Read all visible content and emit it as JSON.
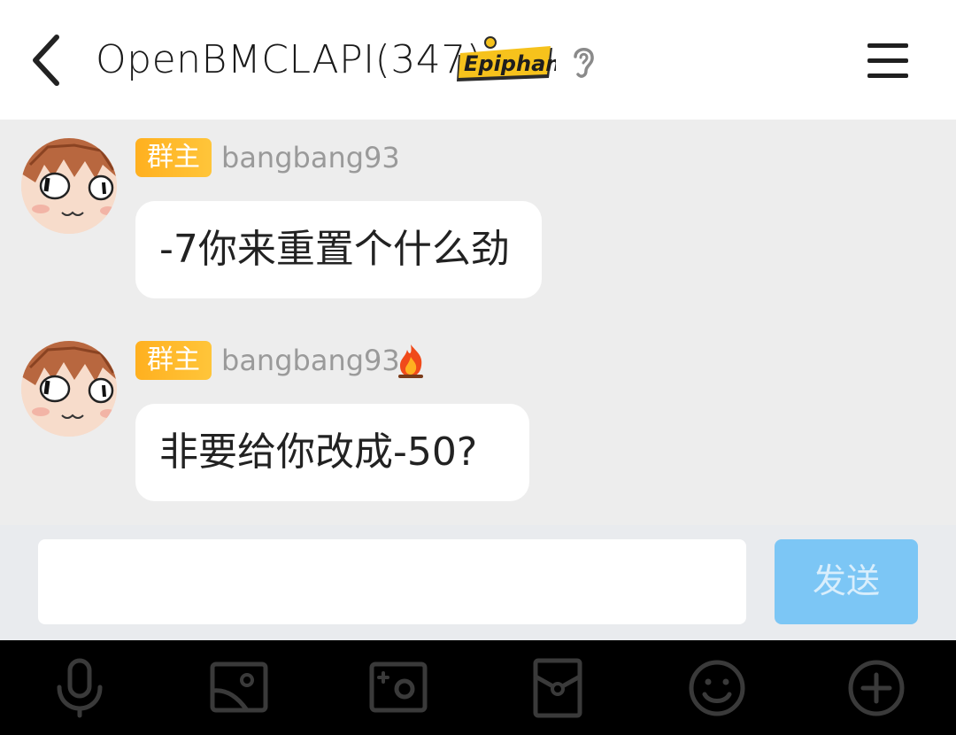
{
  "header": {
    "title": "OpenBMCLAPI(347)",
    "badge_text": "Epiphany",
    "back_icon": "chevron-left-icon",
    "ear_icon": "ear-icon",
    "menu_icon": "menu-icon"
  },
  "messages": [
    {
      "role": "群主",
      "sender": "bangbang93",
      "text": "-7你来重置个什么劲",
      "fire": false
    },
    {
      "role": "群主",
      "sender": "bangbang93",
      "text": "非要给你改成-50?",
      "fire": true
    }
  ],
  "input": {
    "value": "",
    "send_label": "发送"
  },
  "toolbar": {
    "items": [
      "microphone-icon",
      "image-icon",
      "camera-icon",
      "red-packet-icon",
      "emoji-icon",
      "plus-icon"
    ]
  },
  "colors": {
    "role_badge": "#ffb01f",
    "send_button": "#7cc6f5",
    "toolbar_bg": "#000000"
  }
}
